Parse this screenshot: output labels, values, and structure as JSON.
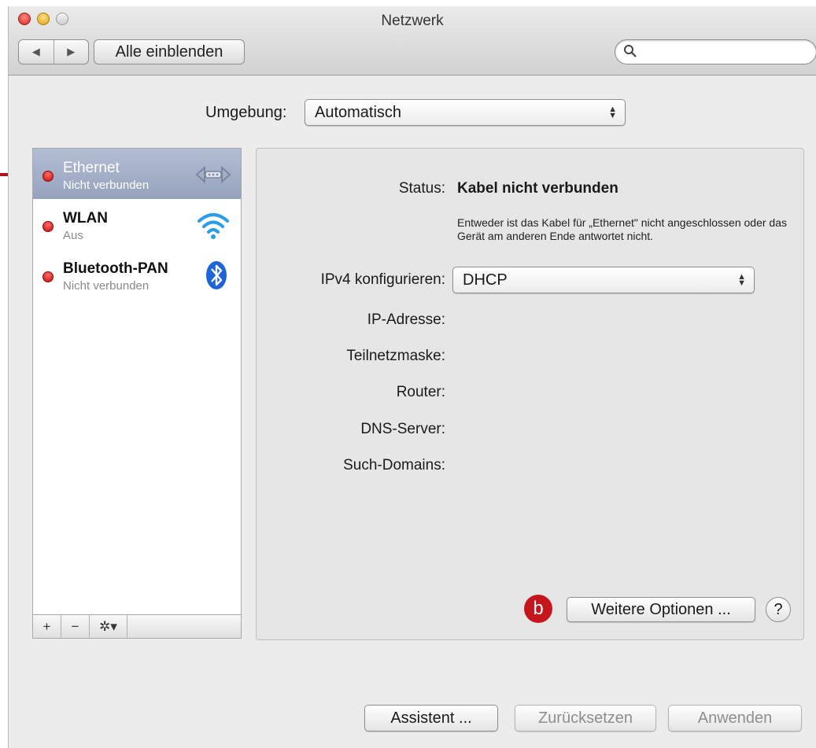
{
  "window": {
    "title": "Netzwerk"
  },
  "toolbar": {
    "back": "◀",
    "forward": "▶",
    "show_all": "Alle einblenden",
    "search_placeholder": ""
  },
  "location": {
    "label": "Umgebung:",
    "value": "Automatisch"
  },
  "services": [
    {
      "name": "Ethernet",
      "status": "Nicht verbunden",
      "icon": "ethernet-icon",
      "selected": true
    },
    {
      "name": "WLAN",
      "status": "Aus",
      "icon": "wifi-icon",
      "selected": false
    },
    {
      "name": "Bluetooth-PAN",
      "status": "Nicht verbunden",
      "icon": "bluetooth-icon",
      "selected": false
    }
  ],
  "sidebar_buttons": {
    "add": "+",
    "remove": "−",
    "action": "✲▾"
  },
  "detail": {
    "status_label": "Status:",
    "status_value": "Kabel nicht verbunden",
    "status_description": "Entweder ist das Kabel für „Ethernet\" nicht angeschlossen oder das Gerät am anderen Ende antwortet nicht.",
    "ipv4_label": "IPv4 konfigurieren:",
    "ipv4_value": "DHCP",
    "ip_label": "IP-Adresse:",
    "subnet_label": "Teilnetzmaske:",
    "router_label": "Router:",
    "dns_label": "DNS-Server:",
    "domains_label": "Such-Domains:",
    "more_options": "Weitere Optionen ...",
    "help": "?",
    "badge": "b"
  },
  "footer": {
    "assistant": "Assistent ...",
    "reset": "Zurücksetzen",
    "apply": "Anwenden"
  },
  "colors": {
    "accent_red": "#c4161c",
    "selection": "#a6b0c8",
    "bluetooth": "#1e63d8",
    "wifi": "#2a9ce8"
  }
}
